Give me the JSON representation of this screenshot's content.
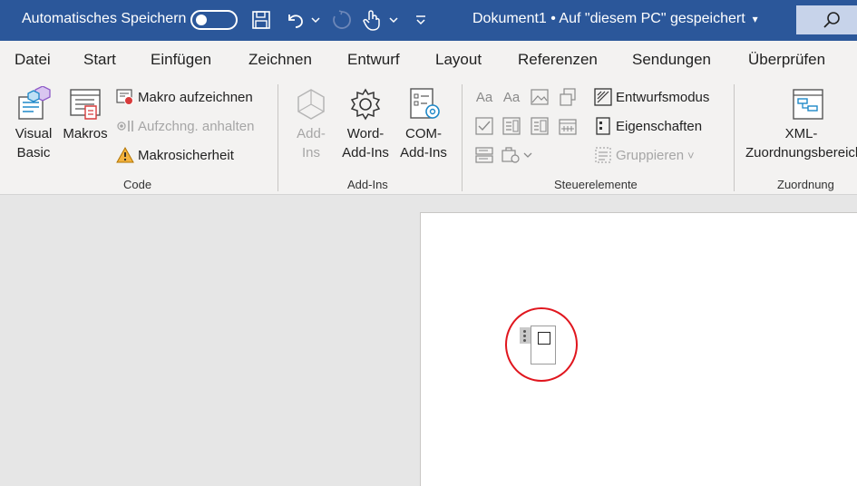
{
  "titlebar": {
    "autosave_label": "Automatisches Speichern",
    "document_title": "Dokument1 • Auf \"diesem PC\" gespeichert",
    "title_caret": "▾",
    "toggle_state": "off"
  },
  "tabs": [
    "Datei",
    "Start",
    "Einfügen",
    "Zeichnen",
    "Entwurf",
    "Layout",
    "Referenzen",
    "Sendungen",
    "Überprüfen"
  ],
  "ribbon": {
    "code": {
      "label": "Code",
      "visual_basic": [
        "Visual",
        "Basic"
      ],
      "makros": "Makros",
      "record_macro": "Makro aufzeichnen",
      "pause_recording": "Aufzchng. anhalten",
      "macro_security": "Makrosicherheit"
    },
    "addins": {
      "label": "Add-Ins",
      "addins": [
        "Add-",
        "Ins"
      ],
      "word_addins": [
        "Word-",
        "Add-Ins"
      ],
      "com_addins": [
        "COM-",
        "Add-Ins"
      ]
    },
    "controls": {
      "label": "Steuerelemente",
      "design_mode": "Entwurfsmodus",
      "properties": "Eigenschaften",
      "group": "Gruppieren",
      "group_caret": "˅"
    },
    "mapping": {
      "label": "Zuordnung",
      "xml_mapping": [
        "XML-",
        "Zuordnungsbereich"
      ]
    }
  },
  "colors": {
    "title_bar": "#2b579a",
    "ribbon_bg": "#f3f2f1",
    "highlight": "#e0161e"
  }
}
